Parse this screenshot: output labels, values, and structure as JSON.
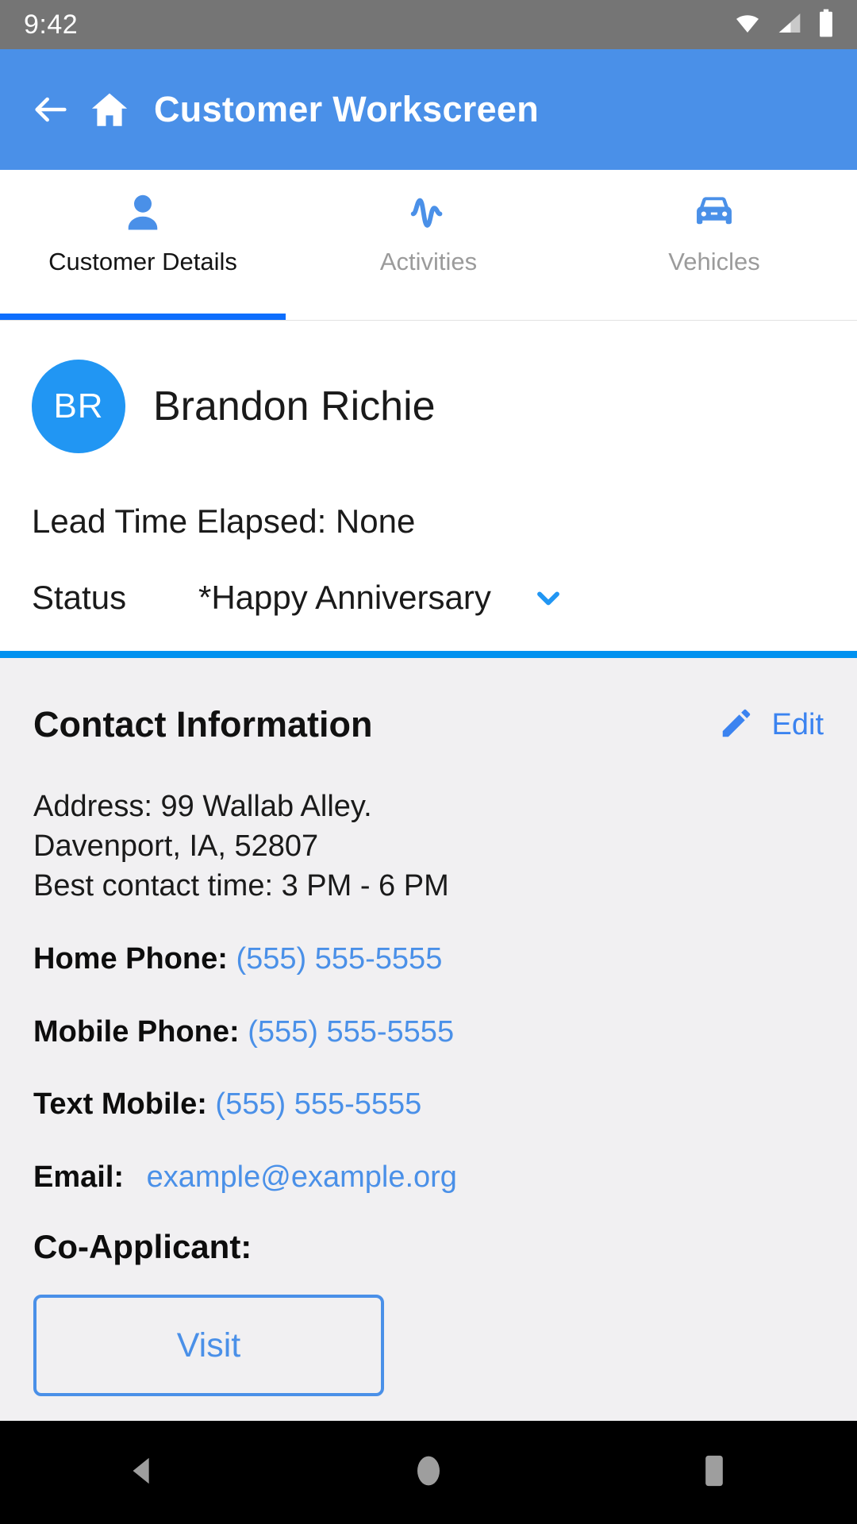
{
  "statusbar": {
    "time": "9:42",
    "icons": [
      "wifi-icon",
      "cell-signal-icon",
      "battery-icon"
    ]
  },
  "appbar": {
    "title": "Customer Workscreen",
    "back_icon": "back-arrow-icon",
    "home_icon": "home-icon",
    "background_color": "#4a90e8"
  },
  "tabs": [
    {
      "label": "Customer Details",
      "icon": "person-icon",
      "active": true
    },
    {
      "label": "Activities",
      "icon": "activity-pulse-icon",
      "active": false
    },
    {
      "label": "Vehicles",
      "icon": "car-icon",
      "active": false
    }
  ],
  "customer": {
    "initials": "BR",
    "name": "Brandon Richie",
    "lead_time": "Lead Time Elapsed: None",
    "status_label": "Status",
    "status_value": "*Happy Anniversary",
    "status_chevron": "chevron-down-icon",
    "avatar_color": "#2196f3"
  },
  "contact": {
    "title": "Contact Information",
    "edit_label": "Edit",
    "edit_icon": "pencil-icon",
    "address_lines": [
      "Address: 99 Wallab Alley.",
      "Davenport, IA, 52807",
      "Best contact time: 3 PM - 6 PM"
    ],
    "fields": [
      {
        "key": "Home Phone:",
        "value": "(555) 555-5555"
      },
      {
        "key": "Mobile Phone:",
        "value": "(555) 555-5555"
      },
      {
        "key": "Text Mobile:",
        "value": "(555) 555-5555"
      }
    ],
    "email": {
      "key": "Email:",
      "value": "example@example.org"
    },
    "coapplicant_label": "Co-Applicant:",
    "visit_button": "Visit",
    "link_color": "#4a90e8",
    "background_color": "#f1f0f2"
  },
  "navbar": {
    "back": "nav-back-icon",
    "home": "nav-home-icon",
    "recents": "nav-recents-icon"
  }
}
